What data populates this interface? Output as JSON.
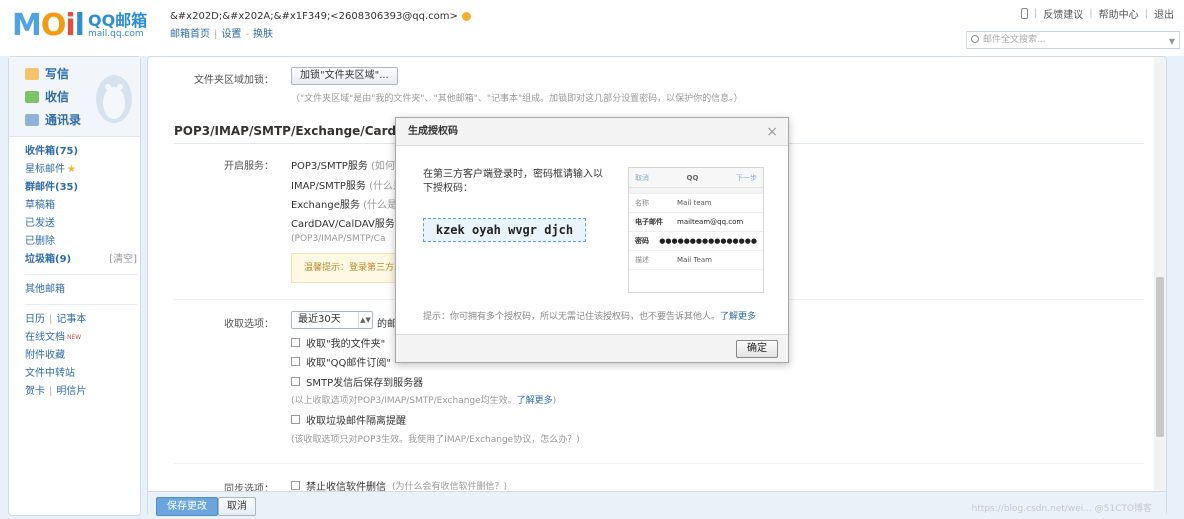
{
  "header": {
    "logo_letters": [
      "M",
      "O",
      "i",
      "l"
    ],
    "logo_name": "QQ邮箱",
    "logo_domain": "mail.qq.com",
    "user_line": "&#x202D;&#x202A;&#x1F349;<2608306393@qq.com>",
    "links": [
      "邮箱首页",
      "设置",
      "换肤"
    ],
    "top_links": [
      "反馈建议",
      "帮助中心",
      "退出"
    ],
    "search_placeholder": "邮件全文搜索..."
  },
  "nav": {
    "big_items": [
      {
        "label": "写信",
        "icon": "compose-icon"
      },
      {
        "label": "收信",
        "icon": "inbox-icon"
      },
      {
        "label": "通讯录",
        "icon": "contacts-icon"
      }
    ],
    "folders": [
      {
        "label": "收件箱(75)",
        "bold": true
      },
      {
        "label": "星标邮件",
        "star": true
      },
      {
        "label": "群邮件(35)",
        "bold": true
      },
      {
        "label": "草稿箱"
      },
      {
        "label": "已发送"
      },
      {
        "label": "已删除"
      },
      {
        "label": "垃圾箱(9)",
        "bold": true,
        "sub": "[清空]"
      }
    ],
    "other": "其他邮箱",
    "tools": {
      "calendar": "日历",
      "notes": "记事本",
      "online_docs": "在线文档",
      "new_tag": "NEW",
      "attachments": "附件收藏",
      "transfer": "文件中转站",
      "greeting": "贺卡",
      "postcard": "明信片"
    }
  },
  "content": {
    "folder_lock_label": "文件夹区域加锁：",
    "folder_lock_button": "加锁\"文件夹区域\"...",
    "folder_lock_hint": "（\"文件夹区域\"是由\"我的文件夹\"、\"其他邮箱\"、\"记事本\"组成。加锁即对这几部分设置密码，以保护你的信息。）",
    "section_title": "POP3/IMAP/SMTP/Exchange/CardD",
    "service_label": "开启服务：",
    "services": [
      {
        "name": "POP3/SMTP服务",
        "note": "(如何使"
      },
      {
        "name": "IMAP/SMTP服务",
        "note": "(什么是"
      },
      {
        "name": "Exchange服务",
        "note": "(什么是E"
      },
      {
        "name": "CardDAV/CalDAV服务",
        "note": "("
      }
    ],
    "services_hint": "(POP3/IMAP/SMTP/Ca",
    "tip": "温馨提示：登录第三方",
    "receive_label": "收取选项：",
    "receive_select": "最近30天",
    "receive_select_suffix": "的邮",
    "options": [
      {
        "label": "收取\"我的文件夹\""
      },
      {
        "label": "收取\"QQ邮件订阅\""
      },
      {
        "label": "SMTP发信后保存到服务器"
      }
    ],
    "options_hint": "(以上收取选项对POP3/IMAP/SMTP/Exchange均生效。",
    "learn_more": "了解更多",
    "options_hint_end": ")",
    "spam_option": "收取垃圾邮件隔离提醒",
    "spam_hint": "(该收取选项只对POP3生效。我使用了IMAP/Exchange协议，怎么办？)",
    "sync_label": "同步选项：",
    "sync_option": "禁止收信软件删信",
    "sync_hint": "(为什么会有收信软件删信？)"
  },
  "bottom": {
    "save": "保存更改",
    "cancel": "取消",
    "watermark": "https://blog.csdn.net/wei... @51CTO博客"
  },
  "modal": {
    "title": "生成授权码",
    "close": "×",
    "desc": "在第三方客户端登录时，密码框请输入以下授权码：",
    "code": "kzek oyah wvgr djch",
    "phone": {
      "cancel": "取消",
      "logo": "QQ",
      "next": "下一步",
      "rows": [
        {
          "k": "名称",
          "v": "Mail team"
        },
        {
          "k": "电子邮件",
          "v": "mailteam@qq.com"
        },
        {
          "k": "密码",
          "v": "●●●●●●●●●●●●●●●●"
        },
        {
          "k": "描述",
          "v": "Mail Team"
        }
      ]
    },
    "tip": "提示：你可拥有多个授权码，所以无需记住该授权码，也不要告诉其他人。",
    "tip_link": "了解更多",
    "ok": "确定"
  }
}
